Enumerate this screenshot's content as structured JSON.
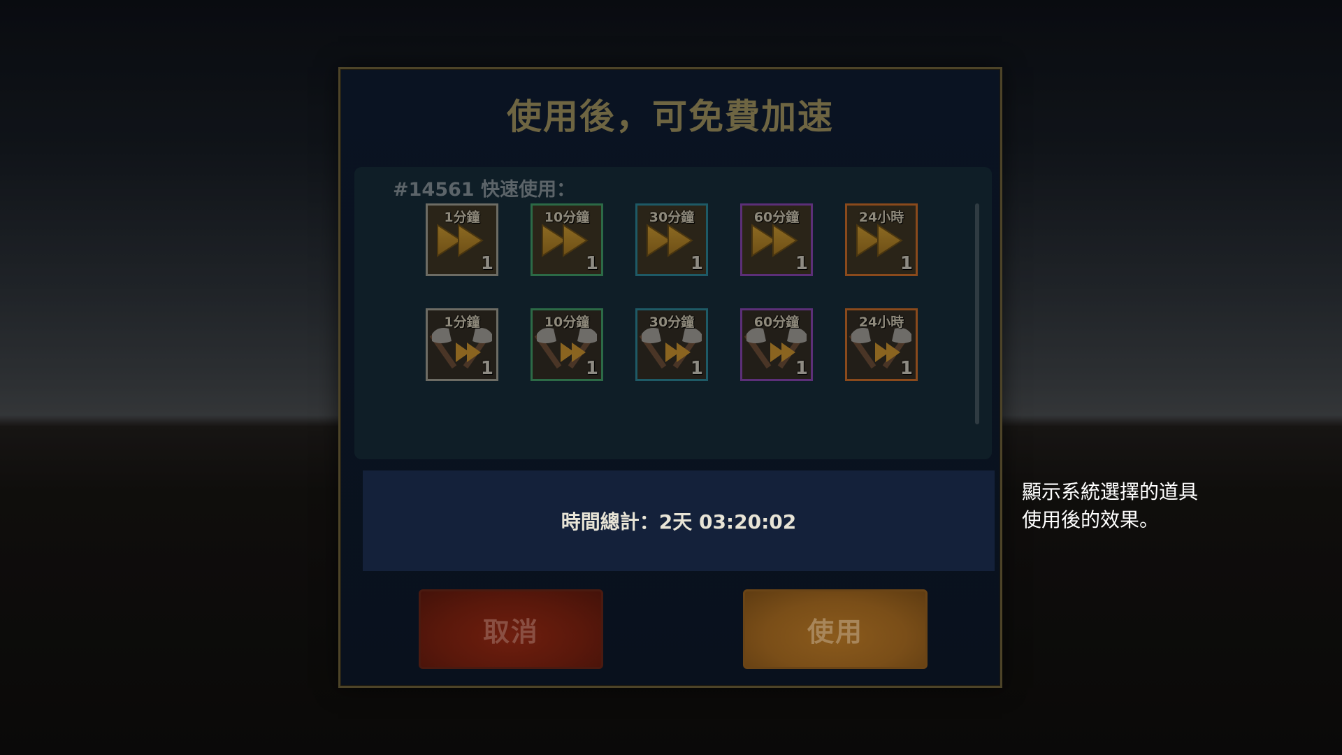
{
  "dialog": {
    "title": "使用後，可免費加速"
  },
  "panel": {
    "heading": "#14561 快速使用："
  },
  "items": [
    {
      "label": "1分鐘",
      "count": "1",
      "icon": "speedup-arrows-icon",
      "rarity": "gray"
    },
    {
      "label": "10分鐘",
      "count": "1",
      "icon": "speedup-arrows-icon",
      "rarity": "green"
    },
    {
      "label": "30分鐘",
      "count": "1",
      "icon": "speedup-arrows-icon",
      "rarity": "cyan"
    },
    {
      "label": "60分鐘",
      "count": "1",
      "icon": "speedup-arrows-icon",
      "rarity": "purple"
    },
    {
      "label": "24小時",
      "count": "1",
      "icon": "speedup-arrows-icon",
      "rarity": "orange"
    },
    {
      "label": "1分鐘",
      "count": "1",
      "icon": "axe-speedup-icon",
      "rarity": "gray"
    },
    {
      "label": "10分鐘",
      "count": "1",
      "icon": "axe-speedup-icon",
      "rarity": "green"
    },
    {
      "label": "30分鐘",
      "count": "1",
      "icon": "axe-speedup-icon",
      "rarity": "cyan"
    },
    {
      "label": "60分鐘",
      "count": "1",
      "icon": "axe-speedup-icon",
      "rarity": "purple"
    },
    {
      "label": "24小時",
      "count": "1",
      "icon": "axe-speedup-icon",
      "rarity": "orange"
    }
  ],
  "total": {
    "text": "時間總計：2天 03:20:02"
  },
  "buttons": {
    "cancel": "取消",
    "use": "使用"
  },
  "side_note": {
    "line1": "顯示系統選擇的道具",
    "line2": "使用後的效果。"
  },
  "colors": {
    "title": "#6e6542",
    "cancel_button": "#5a180b",
    "use_button": "#7a4e18",
    "total_bar": "#14213a"
  }
}
